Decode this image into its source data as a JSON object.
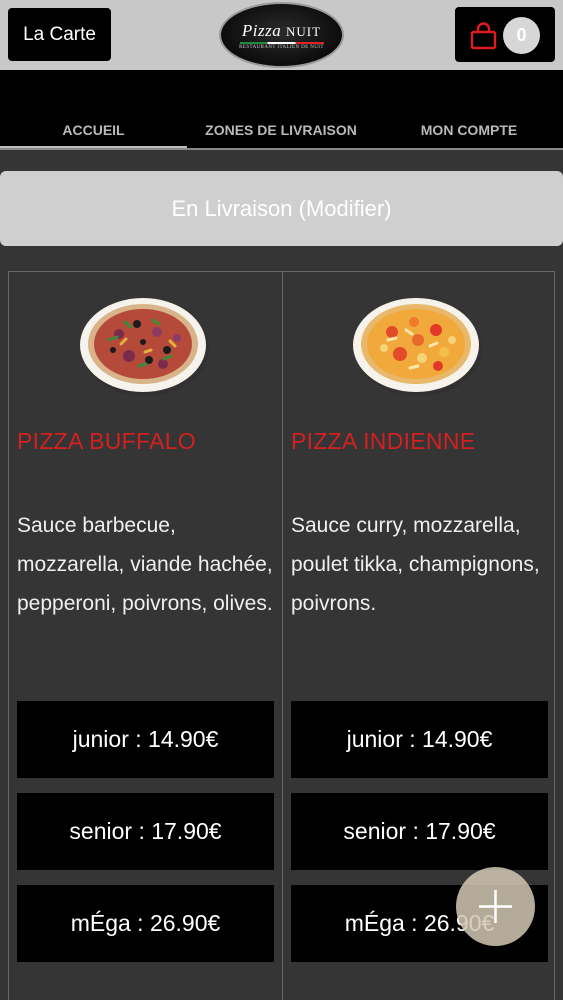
{
  "header": {
    "menu_button": "La Carte",
    "logo": {
      "title": "Pizza Nuit",
      "subtitle": "RESTAURANT ITALIEN DE NUIT"
    },
    "cart": {
      "icon": "shopping-bag-icon",
      "count": "0",
      "accent_color": "#e01b1b"
    }
  },
  "nav": {
    "tabs": [
      {
        "label": "ACCUEIL",
        "active": true
      },
      {
        "label": "ZONES DE LIVRAISON",
        "active": false
      },
      {
        "label": "MON COMPTE",
        "active": false
      }
    ]
  },
  "delivery_button": "En Livraison (Modifier)",
  "products": [
    {
      "name": "PIZZA BUFFALO",
      "description": "Sauce barbecue, mozzarella, viande hachée, pepperoni, poivrons, olives.",
      "prices": [
        {
          "label": "junior : 14.90€"
        },
        {
          "label": "senior : 17.90€"
        },
        {
          "label": "mÉga : 26.90€"
        }
      ]
    },
    {
      "name": "PIZZA INDIENNE",
      "description": "Sauce curry, mozzarella, poulet tikka, champignons, poivrons.",
      "prices": [
        {
          "label": "junior : 14.90€"
        },
        {
          "label": "senior : 17.90€"
        },
        {
          "label": "mÉga : 26.90€"
        }
      ]
    }
  ],
  "fab": {
    "icon": "plus-icon"
  },
  "colors": {
    "product_name": "#d42020",
    "header_bg": "#c9c8c9",
    "page_bg": "#353535"
  }
}
